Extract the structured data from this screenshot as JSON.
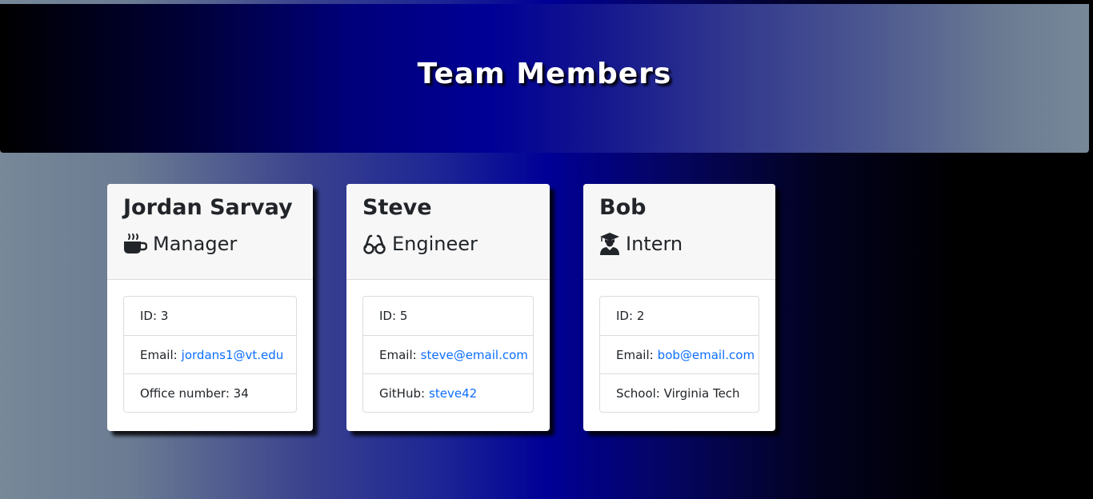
{
  "header": {
    "title": "Team Members"
  },
  "employees": [
    {
      "name": "Jordan Sarvay",
      "role": "Manager",
      "role_icon": "coffee-mug-icon",
      "id_label": "ID:",
      "id": "3",
      "email_label": "Email:",
      "email": "jordans1@vt.edu",
      "extra_label": "Office number:",
      "extra_value": "34"
    },
    {
      "name": "Steve",
      "role": "Engineer",
      "role_icon": "glasses-icon",
      "id_label": "ID:",
      "id": "5",
      "email_label": "Email:",
      "email": "steve@email.com",
      "extra_label": "GitHub:",
      "extra_value": "steve42"
    },
    {
      "name": "Bob",
      "role": "Intern",
      "role_icon": "graduate-icon",
      "id_label": "ID:",
      "id": "2",
      "email_label": "Email:",
      "email": "bob@email.com",
      "extra_label": "School:",
      "extra_value": "Virginia Tech"
    }
  ],
  "colors": {
    "link": "#0d6efd",
    "header_gradient_mid": "#000096",
    "slate": "#778899"
  }
}
